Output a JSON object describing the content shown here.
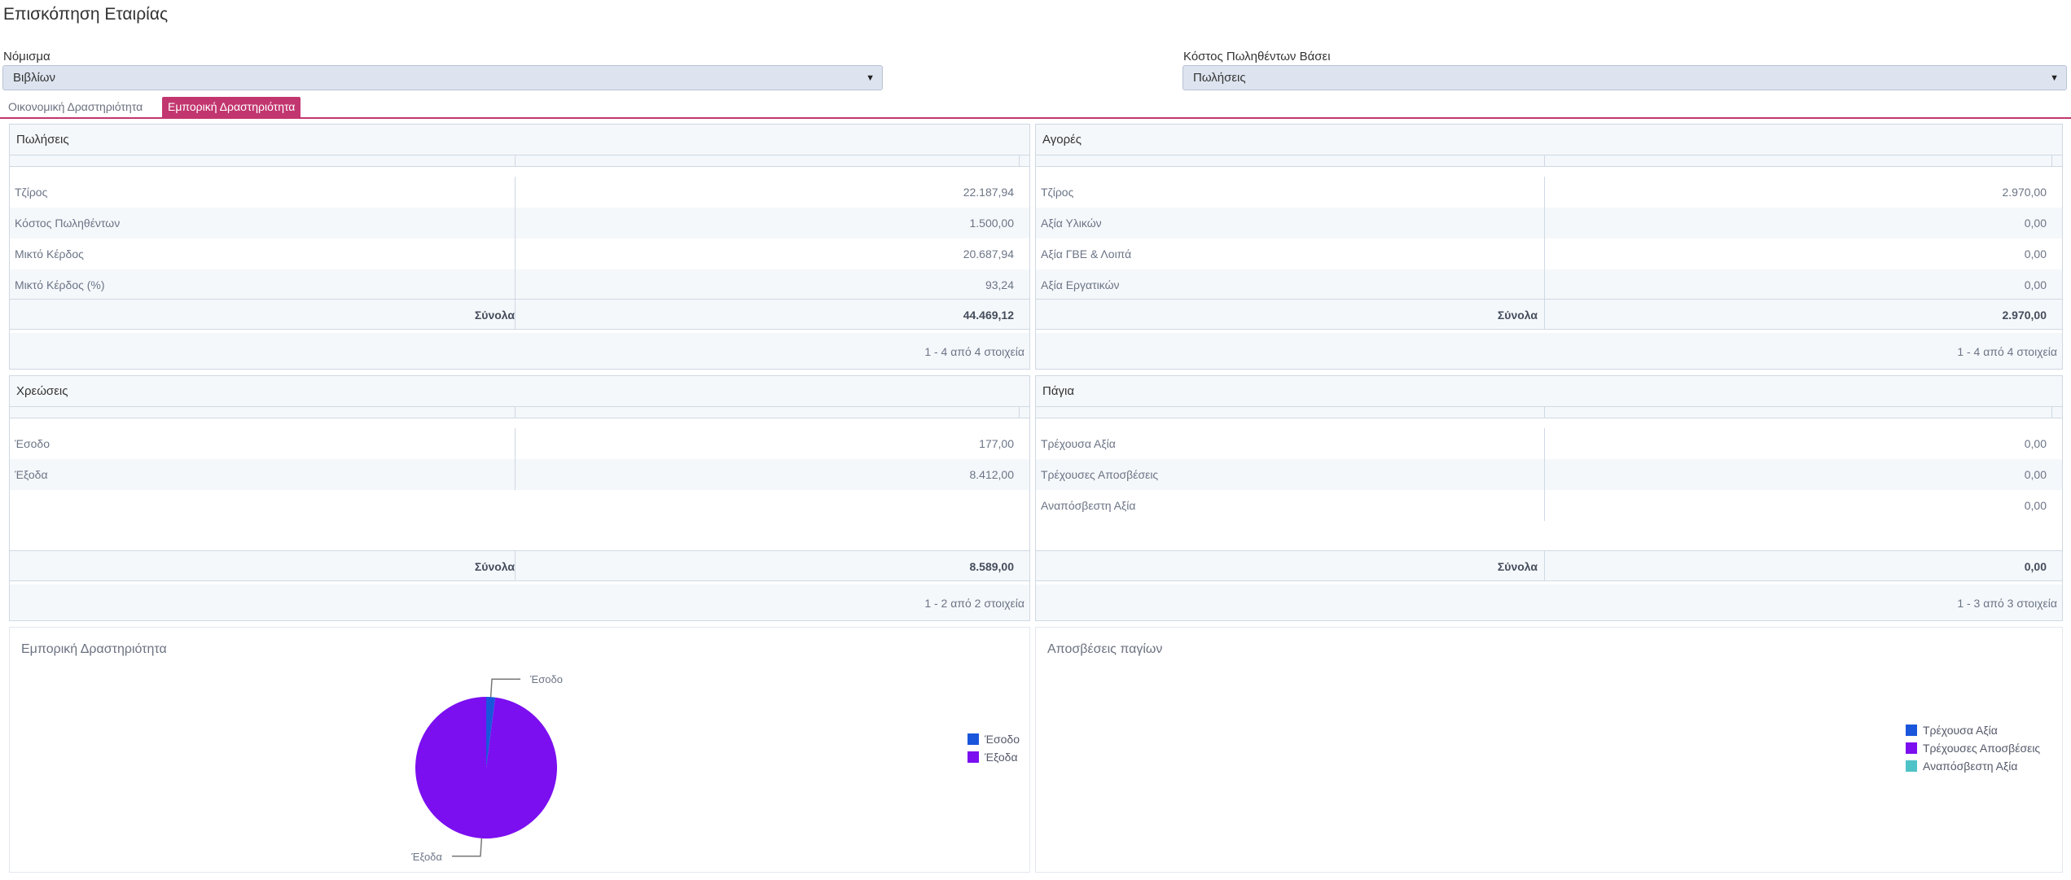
{
  "page_title": "Επισκόπηση Εταιρίας",
  "currency": {
    "label": "Νόμισμα",
    "value": "Βιβλίων"
  },
  "cost_basis": {
    "label": "Κόστος Πωληθέντων Βάσει",
    "value": "Πωλήσεις"
  },
  "tabs": [
    {
      "label": "Οικονομική Δραστηριότητα",
      "active": false
    },
    {
      "label": "Εμπορική Δραστηριότητα",
      "active": true
    }
  ],
  "totals_label": "Σύνολα",
  "grids": {
    "sales": {
      "title": "Πωλήσεις",
      "rows": [
        {
          "label": "Τζίρος",
          "value": "22.187,94"
        },
        {
          "label": "Κόστος Πωληθέντων",
          "value": "1.500,00"
        },
        {
          "label": "Μικτό Κέρδος",
          "value": "20.687,94"
        },
        {
          "label": "Μικτό Κέρδος (%)",
          "value": "93,24"
        }
      ],
      "total": "44.469,12",
      "pager": "1 - 4 από 4 στοιχεία"
    },
    "purchases": {
      "title": "Αγορές",
      "rows": [
        {
          "label": "Τζίρος",
          "value": "2.970,00"
        },
        {
          "label": "Αξία Υλικών",
          "value": "0,00"
        },
        {
          "label": "Αξία ΓΒΕ & Λοιπά",
          "value": "0,00"
        },
        {
          "label": "Αξία Εργατικών",
          "value": "0,00"
        }
      ],
      "total": "2.970,00",
      "pager": "1 - 4 από 4 στοιχεία"
    },
    "charges": {
      "title": "Χρεώσεις",
      "rows": [
        {
          "label": "Έσοδο",
          "value": "177,00"
        },
        {
          "label": "Έξοδα",
          "value": "8.412,00"
        }
      ],
      "total": "8.589,00",
      "pager": "1 - 2 από 2 στοιχεία"
    },
    "assets": {
      "title": "Πάγια",
      "rows": [
        {
          "label": "Τρέχουσα Αξία",
          "value": "0,00"
        },
        {
          "label": "Τρέχουσες Αποσβέσεις",
          "value": "0,00"
        },
        {
          "label": "Αναπόσβεστη Αξία",
          "value": "0,00"
        }
      ],
      "total": "0,00",
      "pager": "1 - 3 από 3 στοιχεία"
    }
  },
  "chart_data": [
    {
      "type": "pie",
      "title": "Εμπορική Δραστηριότητα",
      "categories": [
        "Έσοδο",
        "Έξοδα"
      ],
      "values": [
        177.0,
        8412.0
      ],
      "colors": [
        "#1a56db",
        "#7b0ff0"
      ],
      "legend": "right"
    },
    {
      "type": "pie",
      "title": "Αποσβέσεις παγίων",
      "categories": [
        "Τρέχουσα Αξία",
        "Τρέχουσες Αποσβέσεις",
        "Αναπόσβεστη Αξία"
      ],
      "values": [
        0,
        0,
        0
      ],
      "colors": [
        "#1a56db",
        "#7b0ff0",
        "#4ec3c7"
      ],
      "legend": "right"
    }
  ]
}
